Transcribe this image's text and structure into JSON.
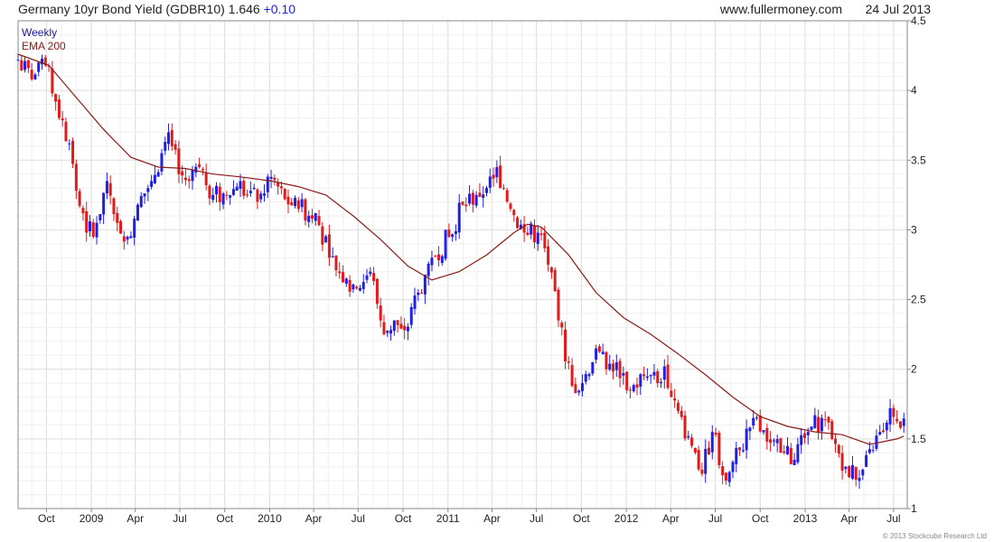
{
  "header": {
    "title": "Germany 10yr Bond Yield (GDBR10) 1.646",
    "change": "+0.10",
    "source": "www.fullermoney.com",
    "date": "24 Jul 2013"
  },
  "copyright": "© 2013 Stockcube Research Ltd",
  "colors": {
    "up": "#1f1fe6",
    "down": "#e01b1b",
    "ema": "#8b1a1a",
    "grid": "#dedede",
    "frame": "#888888"
  },
  "chart_data": {
    "type": "candlestick",
    "interval_label": "Weekly",
    "y_axis_side": "right",
    "ylim": [
      1.0,
      4.5
    ],
    "xlim": [
      "2008-08-04",
      "2013-07-29"
    ],
    "yticks": [
      1,
      1.5,
      2,
      2.5,
      3,
      3.5,
      4,
      4.5
    ],
    "ytick_labels": [
      "1",
      "1.5",
      "2",
      "2.5",
      "3",
      "3.5",
      "4",
      "4.5"
    ],
    "xticks": [
      {
        "date": "2008-10-01",
        "label": "Oct"
      },
      {
        "date": "2009-01-01",
        "label": "2009"
      },
      {
        "date": "2009-04-01",
        "label": "Apr"
      },
      {
        "date": "2009-07-01",
        "label": "Jul"
      },
      {
        "date": "2009-10-01",
        "label": "Oct"
      },
      {
        "date": "2010-01-01",
        "label": "2010"
      },
      {
        "date": "2010-04-01",
        "label": "Apr"
      },
      {
        "date": "2010-07-01",
        "label": "Jul"
      },
      {
        "date": "2010-10-01",
        "label": "Oct"
      },
      {
        "date": "2011-01-01",
        "label": "2011"
      },
      {
        "date": "2011-04-01",
        "label": "Apr"
      },
      {
        "date": "2011-07-01",
        "label": "Jul"
      },
      {
        "date": "2011-10-01",
        "label": "Oct"
      },
      {
        "date": "2012-01-01",
        "label": "2012"
      },
      {
        "date": "2012-04-01",
        "label": "Apr"
      },
      {
        "date": "2012-07-01",
        "label": "Jul"
      },
      {
        "date": "2012-10-01",
        "label": "Oct"
      },
      {
        "date": "2013-01-01",
        "label": "2013"
      },
      {
        "date": "2013-04-01",
        "label": "Apr"
      },
      {
        "date": "2013-07-01",
        "label": "Jul"
      }
    ],
    "series": [
      {
        "name": "Weekly",
        "type": "candlestick",
        "anchors": [
          [
            "2008-08-04",
            4.22
          ],
          [
            "2008-09-01",
            4.08
          ],
          [
            "2008-09-29",
            4.18
          ],
          [
            "2008-10-20",
            3.92
          ],
          [
            "2008-11-17",
            3.62
          ],
          [
            "2008-12-01",
            3.28
          ],
          [
            "2008-12-22",
            2.98
          ],
          [
            "2009-01-12",
            3.05
          ],
          [
            "2009-02-02",
            3.35
          ],
          [
            "2009-02-23",
            3.05
          ],
          [
            "2009-03-16",
            2.95
          ],
          [
            "2009-04-06",
            3.18
          ],
          [
            "2009-05-04",
            3.35
          ],
          [
            "2009-05-25",
            3.55
          ],
          [
            "2009-06-08",
            3.7
          ],
          [
            "2009-06-29",
            3.4
          ],
          [
            "2009-07-20",
            3.35
          ],
          [
            "2009-08-10",
            3.45
          ],
          [
            "2009-09-07",
            3.25
          ],
          [
            "2009-10-05",
            3.25
          ],
          [
            "2009-11-02",
            3.35
          ],
          [
            "2009-12-07",
            3.2
          ],
          [
            "2010-01-04",
            3.38
          ],
          [
            "2010-02-01",
            3.22
          ],
          [
            "2010-03-01",
            3.15
          ],
          [
            "2010-04-05",
            3.12
          ],
          [
            "2010-05-03",
            2.8
          ],
          [
            "2010-06-07",
            2.65
          ],
          [
            "2010-06-28",
            2.58
          ],
          [
            "2010-07-26",
            2.7
          ],
          [
            "2010-08-23",
            2.25
          ],
          [
            "2010-09-13",
            2.35
          ],
          [
            "2010-10-04",
            2.28
          ],
          [
            "2010-11-01",
            2.55
          ],
          [
            "2010-11-29",
            2.8
          ],
          [
            "2011-01-03",
            2.95
          ],
          [
            "2011-01-31",
            3.18
          ],
          [
            "2011-02-28",
            3.25
          ],
          [
            "2011-03-21",
            3.3
          ],
          [
            "2011-04-11",
            3.45
          ],
          [
            "2011-05-09",
            3.15
          ],
          [
            "2011-06-06",
            2.98
          ],
          [
            "2011-07-04",
            2.98
          ],
          [
            "2011-07-25",
            2.75
          ],
          [
            "2011-08-15",
            2.35
          ],
          [
            "2011-09-12",
            1.88
          ],
          [
            "2011-10-03",
            1.9
          ],
          [
            "2011-10-31",
            2.15
          ],
          [
            "2011-11-21",
            2.0
          ],
          [
            "2011-12-12",
            2.05
          ],
          [
            "2012-01-09",
            1.85
          ],
          [
            "2012-02-06",
            1.95
          ],
          [
            "2012-03-05",
            1.9
          ],
          [
            "2012-03-19",
            2.02
          ],
          [
            "2012-04-16",
            1.7
          ],
          [
            "2012-05-14",
            1.45
          ],
          [
            "2012-06-04",
            1.25
          ],
          [
            "2012-06-25",
            1.55
          ],
          [
            "2012-07-23",
            1.2
          ],
          [
            "2012-08-20",
            1.42
          ],
          [
            "2012-09-17",
            1.65
          ],
          [
            "2012-10-15",
            1.48
          ],
          [
            "2012-11-12",
            1.4
          ],
          [
            "2012-12-10",
            1.35
          ],
          [
            "2013-01-07",
            1.55
          ],
          [
            "2013-02-04",
            1.65
          ],
          [
            "2013-02-25",
            1.5
          ],
          [
            "2013-03-25",
            1.3
          ],
          [
            "2013-04-22",
            1.22
          ],
          [
            "2013-05-20",
            1.42
          ],
          [
            "2013-06-10",
            1.55
          ],
          [
            "2013-06-24",
            1.72
          ],
          [
            "2013-07-15",
            1.58
          ],
          [
            "2013-07-22",
            1.646
          ]
        ]
      },
      {
        "name": "EMA 200",
        "type": "line",
        "points": [
          [
            "2008-08-04",
            4.26
          ],
          [
            "2008-10-06",
            4.18
          ],
          [
            "2008-12-01",
            3.95
          ],
          [
            "2009-01-26",
            3.72
          ],
          [
            "2009-03-23",
            3.52
          ],
          [
            "2009-05-18",
            3.45
          ],
          [
            "2009-07-13",
            3.44
          ],
          [
            "2009-09-07",
            3.4
          ],
          [
            "2009-11-02",
            3.38
          ],
          [
            "2010-01-04",
            3.35
          ],
          [
            "2010-03-01",
            3.31
          ],
          [
            "2010-04-26",
            3.25
          ],
          [
            "2010-06-21",
            3.1
          ],
          [
            "2010-08-16",
            2.93
          ],
          [
            "2010-10-11",
            2.74
          ],
          [
            "2010-11-29",
            2.64
          ],
          [
            "2011-01-24",
            2.7
          ],
          [
            "2011-03-21",
            2.82
          ],
          [
            "2011-05-16",
            2.98
          ],
          [
            "2011-06-13",
            3.04
          ],
          [
            "2011-07-11",
            3.02
          ],
          [
            "2011-09-05",
            2.82
          ],
          [
            "2011-10-31",
            2.55
          ],
          [
            "2011-12-26",
            2.37
          ],
          [
            "2012-02-20",
            2.25
          ],
          [
            "2012-04-16",
            2.11
          ],
          [
            "2012-06-11",
            1.96
          ],
          [
            "2012-08-06",
            1.8
          ],
          [
            "2012-10-01",
            1.66
          ],
          [
            "2012-11-26",
            1.59
          ],
          [
            "2013-01-21",
            1.55
          ],
          [
            "2013-03-18",
            1.53
          ],
          [
            "2013-05-13",
            1.46
          ],
          [
            "2013-07-08",
            1.5
          ],
          [
            "2013-07-22",
            1.52
          ]
        ]
      }
    ]
  }
}
